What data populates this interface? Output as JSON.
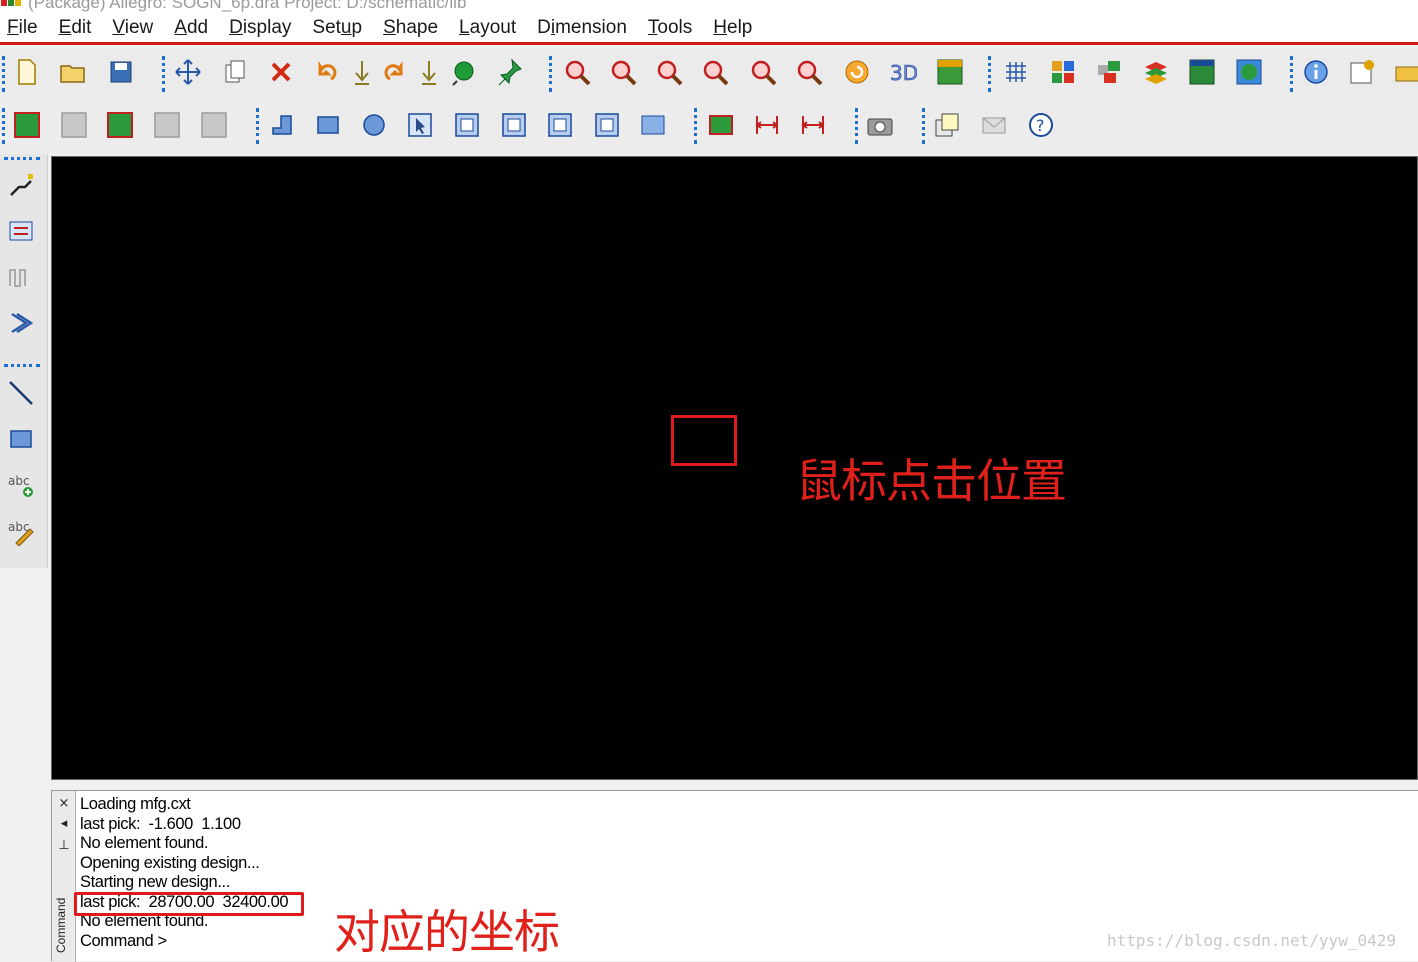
{
  "window": {
    "title": "(Package) Allegro: SOGN_6p.dra  Project: D:/schematic/lib"
  },
  "menu": [
    {
      "label": "File",
      "accel": "F",
      "rest": "ile"
    },
    {
      "label": "Edit",
      "accel": "E",
      "rest": "dit"
    },
    {
      "label": "View",
      "accel": "V",
      "rest": "iew"
    },
    {
      "label": "Add",
      "accel": "A",
      "rest": "dd"
    },
    {
      "label": "Display",
      "accel": "D",
      "rest": "isplay"
    },
    {
      "label": "Setup",
      "accel_pre": "Set",
      "accel": "u",
      "rest": "p"
    },
    {
      "label": "Shape",
      "accel": "S",
      "rest": "hape"
    },
    {
      "label": "Layout",
      "accel": "L",
      "rest": "ayout"
    },
    {
      "label": "Dimension",
      "accel_pre": "D",
      "accel": "i",
      "rest": "mension"
    },
    {
      "label": "Tools",
      "accel": "T",
      "rest": "ools"
    },
    {
      "label": "Help",
      "accel": "H",
      "rest": "elp"
    }
  ],
  "toolbar_icons_row1": [
    "new-file-icon",
    "open-folder-icon",
    "save-icon",
    "move-icon",
    "copy-icon",
    "delete-icon",
    "undo-icon",
    "down-arrow-icon",
    "redo-icon",
    "down-arrow-2-icon",
    "ratsnest-icon",
    "pin-icon",
    "zoom-fit-icon",
    "zoom-in-box-icon",
    "zoom-in-icon",
    "zoom-out-icon",
    "zoom-previous-icon",
    "zoom-world-icon",
    "refresh-icon",
    "3d-view-icon",
    "flip-board-icon",
    "grid-icon",
    "color-palette-icon",
    "layer-visibility-icon",
    "layers-stack-icon",
    "constraint-manager-icon",
    "globe-icon",
    "info-icon",
    "properties-icon",
    "measure-icon"
  ],
  "toolbar_icons_row2": [
    "shape-green-icon",
    "shape-gray-icon",
    "shape-route-icon",
    "shape-gray-2-icon",
    "shape-gray-3-icon",
    "add-line-step-icon",
    "add-rectangle-icon",
    "add-circle-icon",
    "select-shape-icon",
    "merge-shapes-icon",
    "shape-void-icon",
    "shape-square-icon",
    "shape-round-icon",
    "shape-edit-icon",
    "chip-icon",
    "dimension-linear-icon",
    "dimension-horizontal-icon",
    "camera-icon",
    "copy-window-icon",
    "mail-icon",
    "help-icon"
  ],
  "left_toolbar_icons": [
    "add-connect-icon",
    "slide-icon",
    "delay-tune-icon",
    "fanout-icon",
    "add-line-icon",
    "add-rect-icon",
    "add-text-icon",
    "edit-text-icon"
  ],
  "canvas": {
    "annotation": "鼠标点击位置"
  },
  "command_panel": {
    "side_label": "Command",
    "close_glyph": "×",
    "arrow_glyph": "◂",
    "pin_glyph": "⊥",
    "lines": [
      "Loading mfg.cxt",
      "last pick:  -1.600  1.100",
      "No element found.",
      "Opening existing design...",
      "Starting new design...",
      "last pick:  28700.00  32400.00",
      "No element found.",
      "Command >"
    ],
    "annotation": "对应的坐标",
    "watermark": "https://blog.csdn.net/yyw_0429"
  },
  "colors": {
    "canvas_bg": "#000000",
    "annotation_red": "#e0201a",
    "menu_underline_red": "#d21919",
    "grip_blue": "#1a6fd1"
  }
}
